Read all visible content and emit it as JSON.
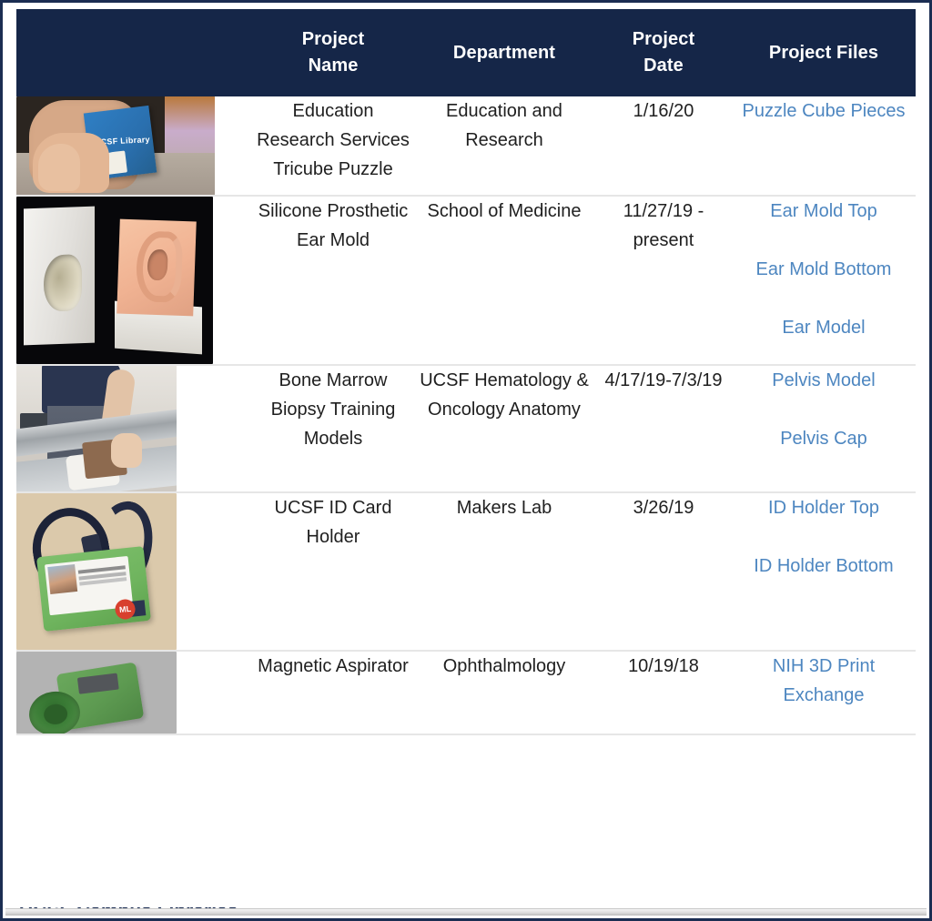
{
  "table": {
    "columns": [
      {
        "key": "thumbnail",
        "label": ""
      },
      {
        "key": "name",
        "label": "Project\nName"
      },
      {
        "key": "department",
        "label": "Department"
      },
      {
        "key": "date",
        "label": "Project\nDate"
      },
      {
        "key": "files",
        "label": "Project Files"
      }
    ],
    "header": {
      "blank": "",
      "project_name_line1": "Project",
      "project_name_line2": "Name",
      "department": "Department",
      "project_date_line1": "Project",
      "project_date_line2": "Date",
      "project_files": "Project Files"
    },
    "rows": [
      {
        "thumbnail_alt": "hand-holding-ucsf-library-tricube-puzzle-photo",
        "thumbnail_label": "UCSF Library",
        "name": "Education Research Services Tricube Puzzle",
        "department": "Education and Research",
        "department_secondary": "",
        "date": "1/16/20",
        "files": [
          "Puzzle Cube Pieces"
        ]
      },
      {
        "thumbnail_alt": "silicone-prosthetic-ear-mold-photo",
        "thumbnail_label": "",
        "name": "Silicone Prosthetic Ear Mold",
        "department": "School of Medicine",
        "department_secondary": "",
        "date": "11/27/19 - present",
        "files": [
          "Ear Mold Top",
          "Ear Mold Bottom",
          "Ear Model"
        ]
      },
      {
        "thumbnail_alt": "bone-marrow-biopsy-training-photo",
        "thumbnail_label": "",
        "name": "Bone Marrow Biopsy Training Models",
        "department": "UCSF Hematology & Oncology",
        "department_secondary": "Anatomy",
        "date": "4/17/19-7/3/19",
        "files": [
          "Pelvis Model",
          "Pelvis Cap"
        ]
      },
      {
        "thumbnail_alt": "ucsf-id-card-holder-photo",
        "thumbnail_label": "ML",
        "name": "UCSF ID Card Holder",
        "department": "Makers Lab",
        "department_secondary": "",
        "date": "3/26/19",
        "files": [
          "ID Holder Top",
          "ID Holder Bottom"
        ]
      },
      {
        "thumbnail_alt": "magnetic-aspirator-3d-model-photo",
        "thumbnail_label": "",
        "name": "Magnetic Aspirator",
        "department": "Ophthalmology",
        "department_secondary": "",
        "date": "10/19/18",
        "files": [
          "NIH 3D Print Exchange"
        ]
      }
    ]
  },
  "footer": {
    "clipped_text": "UCSF Campus Libraries"
  },
  "colors": {
    "header_background": "#152648",
    "header_text": "#ffffff",
    "page_border": "#1b2d52",
    "link": "#4d86c0",
    "body_text": "#1f1f1f",
    "row_divider": "#e6e6e6",
    "page_background": "#ffffff"
  }
}
